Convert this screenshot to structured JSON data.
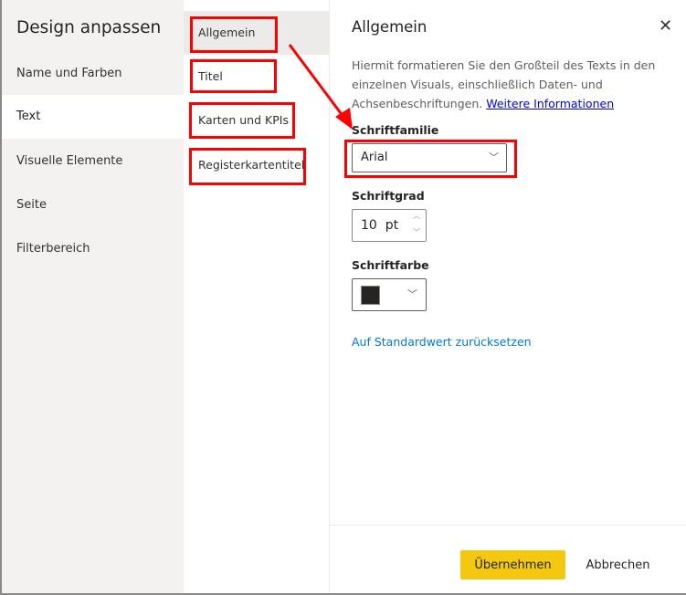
{
  "left": {
    "title": "Design anpassen",
    "items": [
      {
        "label": "Name und Farben",
        "selected": false
      },
      {
        "label": "Text",
        "selected": true
      },
      {
        "label": "Visuelle Elemente",
        "selected": false
      },
      {
        "label": "Seite",
        "selected": false
      },
      {
        "label": "Filterbereich",
        "selected": false
      }
    ]
  },
  "middle": {
    "items": [
      {
        "label": "Allgemein",
        "selected": true
      },
      {
        "label": "Titel"
      },
      {
        "label": "Karten und KPIs"
      },
      {
        "label": "Registerkartentitel"
      }
    ]
  },
  "right": {
    "title": "Allgemein",
    "close_icon": "close-icon",
    "description": "Hiermit formatieren Sie den Großteil des Texts in den einzelnen Visuals, einschließlich Daten- und Achsenbeschriftungen.",
    "more_link": "Weitere Informationen",
    "font_family": {
      "label": "Schriftfamilie",
      "value": "Arial"
    },
    "font_size": {
      "label": "Schriftgrad",
      "value": "10",
      "unit": "pt"
    },
    "font_color": {
      "label": "Schriftfarbe",
      "value": "#252423"
    },
    "reset": "Auf Standardwert zurücksetzen"
  },
  "footer": {
    "apply": "Übernehmen",
    "cancel": "Abbrechen"
  },
  "colors": {
    "accent": "#f2c811",
    "annotation": "#ff0000",
    "link": "#0078d4"
  }
}
